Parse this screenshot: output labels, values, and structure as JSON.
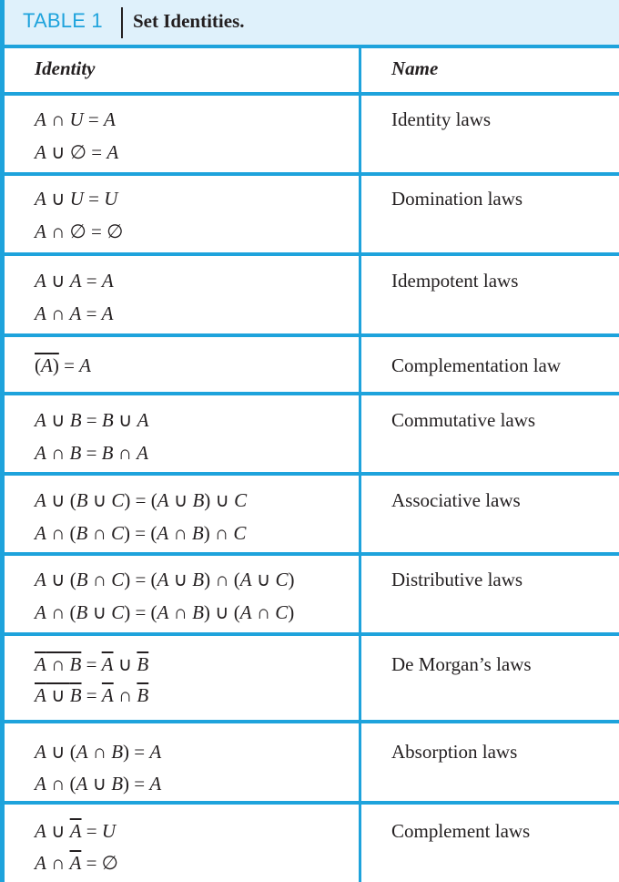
{
  "table": {
    "label": "TABLE 1",
    "title": "Set Identities.",
    "accent_color": "#1ea3dc",
    "header_bg": "#dff1fb",
    "columns": [
      "Identity",
      "Name"
    ],
    "rows": [
      {
        "identities": [
          "A ∩ U = A",
          "A ∪ ∅ = A"
        ],
        "name": "Identity laws"
      },
      {
        "identities": [
          "A ∪ U = U",
          "A ∩ ∅ = ∅"
        ],
        "name": "Domination laws"
      },
      {
        "identities": [
          "A ∪ A = A",
          "A ∩ A = A"
        ],
        "name": "Idempotent laws"
      },
      {
        "identities": [
          "(A̅)̅ = A"
        ],
        "name": "Complementation law"
      },
      {
        "identities": [
          "A ∪ B = B ∪ A",
          "A ∩ B = B ∩ A"
        ],
        "name": "Commutative laws"
      },
      {
        "identities": [
          "A ∪ (B ∪ C) = (A ∪ B) ∪ C",
          "A ∩ (B ∩ C) = (A ∩ B) ∩ C"
        ],
        "name": "Associative laws"
      },
      {
        "identities": [
          "A ∪ (B ∩ C) = (A ∪ B) ∩ (A ∪ C)",
          "A ∩ (B ∪ C) = (A ∩ B) ∪ (A ∩ C)"
        ],
        "name": "Distributive laws"
      },
      {
        "identities": [
          "(A ∩ B)̅ = A̅ ∪ B̅",
          "(A ∪ B)̅ = A̅ ∩ B̅"
        ],
        "name": "De Morgan’s laws"
      },
      {
        "identities": [
          "A ∪ (A ∩ B) = A",
          "A ∩ (A ∪ B) = A"
        ],
        "name": "Absorption laws"
      },
      {
        "identities": [
          "A ∪ A̅ = U",
          "A ∩ A̅ = ∅"
        ],
        "name": "Complement laws"
      }
    ]
  }
}
